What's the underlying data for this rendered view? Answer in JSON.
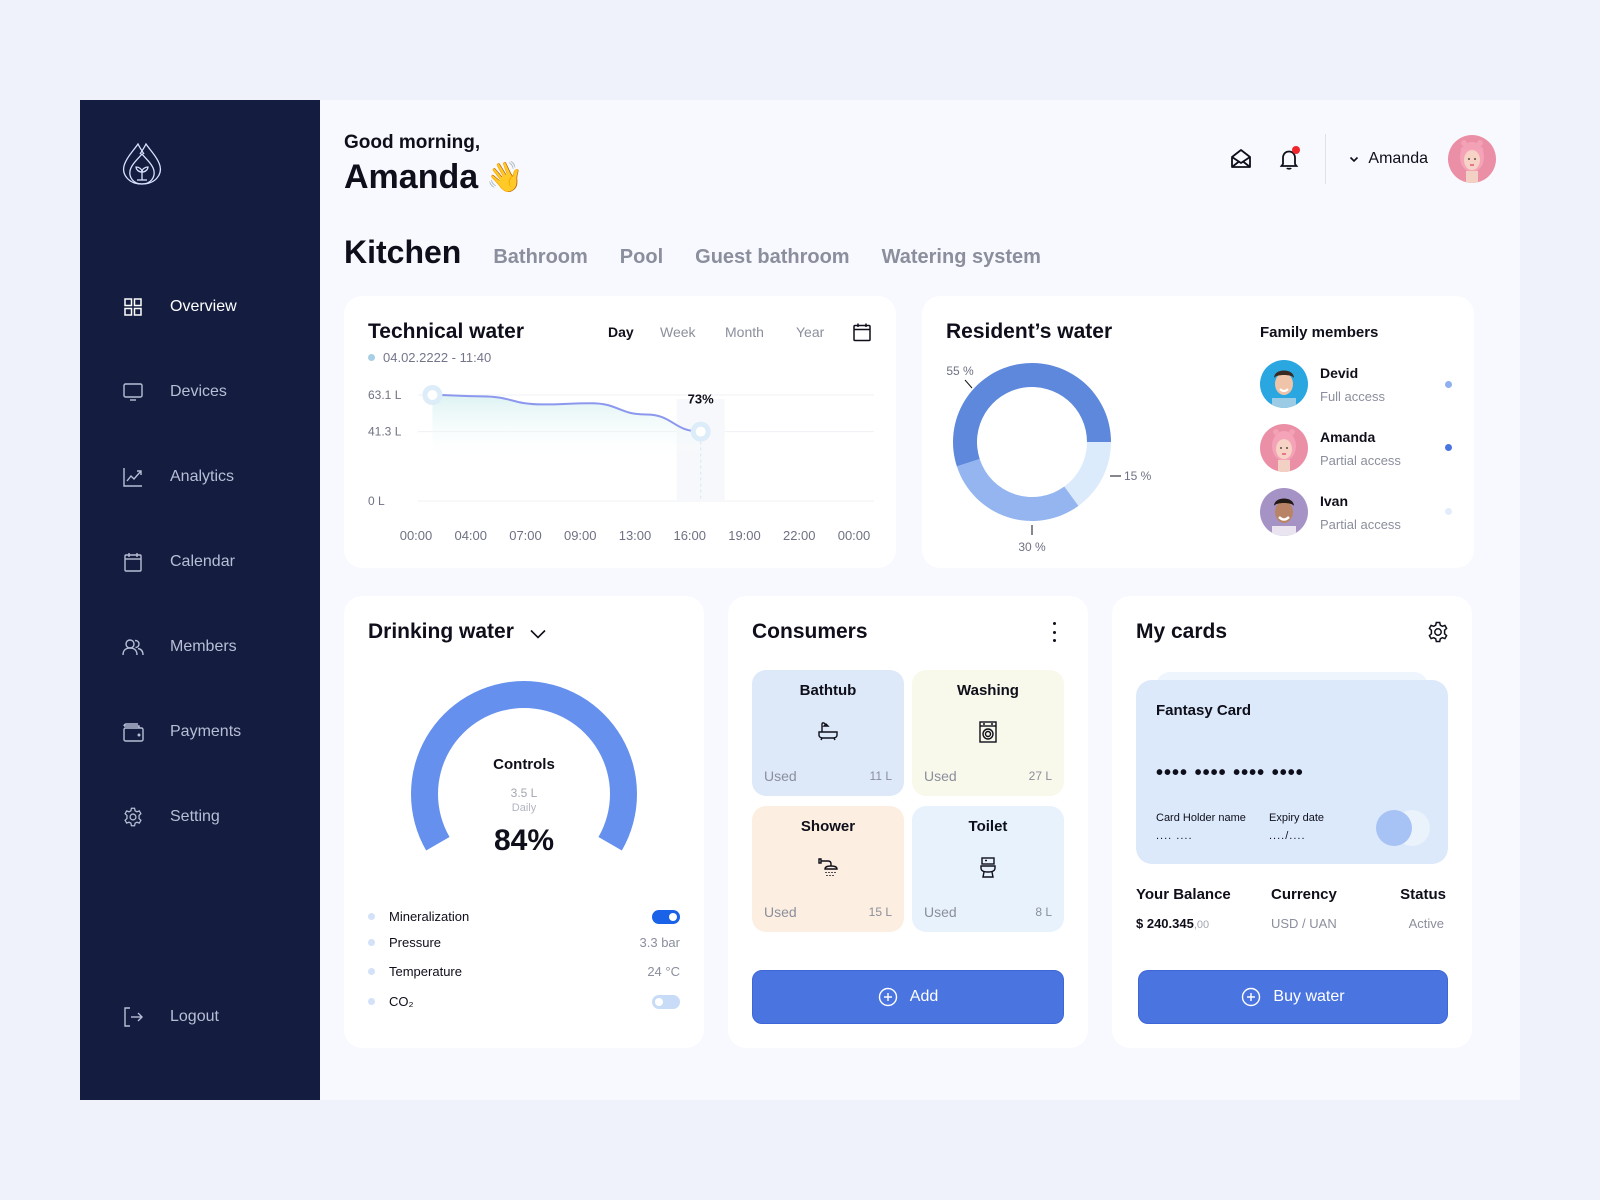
{
  "sidebar": {
    "logo": "water-drop-leaf-logo",
    "items": [
      {
        "label": "Overview",
        "icon": "grid-icon",
        "active": true
      },
      {
        "label": "Devices",
        "icon": "monitor-icon",
        "active": false
      },
      {
        "label": "Analytics",
        "icon": "chart-line-icon",
        "active": false
      },
      {
        "label": "Calendar",
        "icon": "calendar-icon",
        "active": false
      },
      {
        "label": "Members",
        "icon": "users-icon",
        "active": false
      },
      {
        "label": "Payments",
        "icon": "wallet-icon",
        "active": false
      },
      {
        "label": "Setting",
        "icon": "gear-icon",
        "active": false
      }
    ],
    "logout": {
      "label": "Logout",
      "icon": "logout-icon"
    }
  },
  "header": {
    "greeting": "Good morning,",
    "name": "Amanda",
    "wave": "👋",
    "user": {
      "name": "Amanda"
    },
    "icons": [
      "mail-icon",
      "bell-icon"
    ],
    "has_notification": true
  },
  "rooms": {
    "active": "Kitchen",
    "tabs": [
      "Kitchen",
      "Bathroom",
      "Pool",
      "Guest bathroom",
      "Watering system"
    ]
  },
  "technical_water": {
    "title": "Technical water",
    "date": "04.02.2222 - 11:40",
    "ranges": [
      "Day",
      "Week",
      "Month",
      "Year"
    ],
    "active_range": "Day",
    "highlight_label": "73%"
  },
  "residents_water": {
    "title": "Resident’s water",
    "family_title": "Family members",
    "members": [
      {
        "name": "Devid",
        "access": "Full access",
        "dot_color": "#8fb0ee"
      },
      {
        "name": "Amanda",
        "access": "Partial access",
        "dot_color": "#4a74e0"
      },
      {
        "name": "Ivan",
        "access": "Partial access",
        "dot_color": "#e3ecfb"
      }
    ]
  },
  "drinking_water": {
    "title": "Drinking water",
    "gauge": {
      "label": "Controls",
      "amount": "3.5 L",
      "period": "Daily",
      "percent_text": "84%",
      "percent": 84
    },
    "controls": [
      {
        "label": "Mineralization",
        "type": "toggle",
        "on": true
      },
      {
        "label": "Pressure",
        "type": "value",
        "value": "3.3 bar"
      },
      {
        "label": "Temperature",
        "type": "value",
        "value": "24 °C"
      },
      {
        "label": "CO₂",
        "type": "toggle",
        "on": false
      }
    ]
  },
  "consumers": {
    "title": "Consumers",
    "items": [
      {
        "name": "Bathtub",
        "icon": "bathtub-icon",
        "used_label": "Used",
        "value": "11 L",
        "bg": "#dde9f9"
      },
      {
        "name": "Washing",
        "icon": "washing-machine-icon",
        "used_label": "Used",
        "value": "27 L",
        "bg": "#f8f8eb"
      },
      {
        "name": "Shower",
        "icon": "shower-icon",
        "used_label": "Used",
        "value": "15 L",
        "bg": "#fcefe1"
      },
      {
        "name": "Toilet",
        "icon": "toilet-icon",
        "used_label": "Used",
        "value": "8 L",
        "bg": "#e8f2fd"
      }
    ],
    "add_label": "Add"
  },
  "my_cards": {
    "title": "My cards",
    "card": {
      "name": "Fantasy Card",
      "number_mask": "•••• •••• •••• ••••",
      "holder_label": "Card Holder name",
      "holder_mask": ".... ....",
      "expiry_label": "Expiry date",
      "expiry_mask": "..../...."
    },
    "balance_label": "Your Balance",
    "balance_main": "$ 240.345",
    "balance_cents": ",00",
    "currency_label": "Currency",
    "currency_value": "USD / UAN",
    "status_label": "Status",
    "status_value": "Active",
    "buy_label": "Buy water"
  },
  "chart_data": [
    {
      "type": "line",
      "title": "Technical water",
      "x": [
        "00:00",
        "04:00",
        "07:00",
        "09:00",
        "13:00",
        "16:00",
        "19:00",
        "22:00",
        "00:00"
      ],
      "yticks": [
        "63.1 L",
        "41.3 L",
        "0 L"
      ],
      "ytick_values": [
        63.1,
        41.3,
        0
      ],
      "ylim": [
        0,
        63.1
      ],
      "series": [
        {
          "name": "Technical water",
          "points": [
            [
              0.3,
              63.1
            ],
            [
              1.2,
              62.3
            ],
            [
              2.3,
              57.5
            ],
            [
              3.2,
              58.2
            ],
            [
              4.2,
              51.5
            ],
            [
              5.2,
              41.3
            ]
          ]
        }
      ],
      "annotation": {
        "x_index": 5.2,
        "label": "73%"
      },
      "grid": true
    },
    {
      "type": "pie",
      "title": "Resident’s water",
      "donut": true,
      "slices": [
        {
          "label": "15 %",
          "value": 15,
          "color": "#dcebfc"
        },
        {
          "label": "30 %",
          "value": 30,
          "color": "#95b5f0"
        },
        {
          "label": "55 %",
          "value": 55,
          "color": "#5d88db"
        }
      ]
    }
  ]
}
